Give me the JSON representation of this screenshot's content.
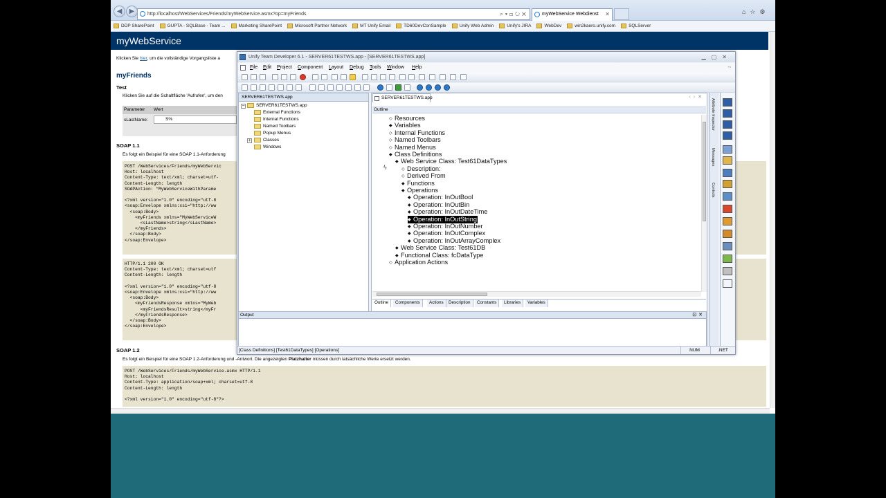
{
  "browser": {
    "url": "http://localhost/WebServices/Friends/myWebService.asmx?op=myFriends",
    "tab_title": "myWebService Webdienst",
    "favorites": [
      "DDP SharePoint",
      "GUPTA - SQLBase - Team ...",
      "Marketing SharePoint",
      "Microsoft Partner Network",
      "MT Unify Email",
      "TD60DevConSample",
      "Unify Web Admin",
      "Unify's JIRA",
      "WebDev",
      "win2kaero.unify.com",
      "SQLServer"
    ]
  },
  "page": {
    "service_title": "myWebService",
    "intro_prefix": "Klicken Sie ",
    "intro_link": "hier",
    "intro_suffix": ", um die vollständige Vorgangsliste a",
    "operation_title": "myFriends",
    "test_heading": "Test",
    "test_desc": "Klicken Sie auf die Schaltfläche 'Aufrufen', um den",
    "param_header_name": "Parameter",
    "param_header_value": "Wert",
    "param_name": "sLastName:",
    "param_value": "S%",
    "soap11_heading": "SOAP 1.1",
    "soap11_desc": "Es folgt ein Beispiel für eine SOAP 1.1-Anforderung",
    "soap11_request": "POST /WebServices/Friends/myWebServic\nHost: localhost\nContent-Type: text/xml; charset=utf-\nContent-Length: length\nSOAPAction: \"MyWebServiceWithParame\n\n<?xml version=\"1.0\" encoding=\"utf-8\n<soap:Envelope xmlns:xsi=\"http://ww\n  <soap:Body>\n    <myFriends xmlns=\"MyWebServiceW\n      <sLastName>string</sLastName>\n    </myFriends>\n  </soap:Body>\n</soap:Envelope>",
    "soap11_response": "HTTP/1.1 200 OK\nContent-Type: text/xml; charset=utf\nContent-Length: length\n\n<?xml version=\"1.0\" encoding=\"utf-8\n<soap:Envelope xmlns:xsi=\"http://ww\n  <soap:Body>\n    <myFriendsResponse xmlns=\"MyWeb\n      <myFriendsResult>string</myFr\n    </myFriendsResponse>\n  </soap:Body>\n</soap:Envelope>",
    "soap12_heading": "SOAP 1.2",
    "soap12_desc_prefix": "Es folgt ein Beispiel für eine SOAP 1.2-Anforderung und -Antwort. Die angezeigten ",
    "soap12_desc_bold": "Platzhalter",
    "soap12_desc_suffix": " müssen durch tatsächliche Werte ersetzt werden.",
    "soap12_request": "POST /WebServices/Friends/myWebService.asmx HTTP/1.1\nHost: localhost\nContent-Type: application/soap+xml; charset=utf-8\nContent-Length: length\n\n<?xml version=\"1.0\" encoding=\"utf-8\"?>"
  },
  "td": {
    "title": "Unify Team Developer 6.1 - SERVER61TESTWS.app - [SERVER61TESTWS.app]",
    "menus": [
      "File",
      "Edit",
      "Project",
      "Component",
      "Layout",
      "Debug",
      "Tools",
      "Window",
      "Help"
    ],
    "left_tab": "SERVER61TESTWS.app",
    "tree": {
      "root": "SERVER61TESTWS.app",
      "items": [
        "External Functions",
        "Internal Functions",
        "Named Toolbars",
        "Popup Menus",
        "Classes",
        "Windows"
      ]
    },
    "doc_tab": "SERVER61TESTWS.app",
    "outline_label": "Outline",
    "outline": [
      {
        "text": "Resources",
        "level": 0,
        "bullet": "◇"
      },
      {
        "text": "Variables",
        "level": 0,
        "bullet": "◆"
      },
      {
        "text": "Internal Functions",
        "level": 0,
        "bullet": "◇"
      },
      {
        "text": "Named Toolbars",
        "level": 0,
        "bullet": "◇"
      },
      {
        "text": "Named Menus",
        "level": 0,
        "bullet": "◇"
      },
      {
        "text": "Class Definitions",
        "level": 0,
        "bullet": "◆"
      },
      {
        "text": "Web Service Class: Test61DataTypes",
        "level": 1,
        "bullet": "◆"
      },
      {
        "text": "Description:",
        "level": 2,
        "bullet": "◇"
      },
      {
        "text": "Derived From",
        "level": 2,
        "bullet": "◇"
      },
      {
        "text": "Functions",
        "level": 2,
        "bullet": "◆"
      },
      {
        "text": "Operations",
        "level": 2,
        "bullet": "◆"
      },
      {
        "text": "Operation: InOutBool",
        "level": 3,
        "bullet": "◆"
      },
      {
        "text": "Operation: InOutBin",
        "level": 3,
        "bullet": "◆"
      },
      {
        "text": "Operation: InOutDateTime",
        "level": 3,
        "bullet": "◆"
      },
      {
        "text": "Operation: InOutString",
        "level": 3,
        "bullet": "◆"
      },
      {
        "text": "Operation: InOutNumber",
        "level": 3,
        "bullet": "◆"
      },
      {
        "text": "Operation: InOutComplex",
        "level": 3,
        "bullet": "◆"
      },
      {
        "text": "Operation: InOutArrayComplex",
        "level": 3,
        "bullet": "◆"
      },
      {
        "text": "Web Service Class: Test61DB",
        "level": 1,
        "bullet": "◆"
      },
      {
        "text": "Functional Class: fcDataType",
        "level": 1,
        "bullet": "◆"
      },
      {
        "text": "Application Actions",
        "level": 0,
        "bullet": "◇"
      }
    ],
    "selected_index": 14,
    "bottom_tabs": [
      "Outline",
      "Components",
      "Actions",
      "Description",
      "Constants",
      "Libraries",
      "Variables"
    ],
    "side_tabs": [
      "Attribute Inspector",
      "Messages",
      "Controls"
    ],
    "output_label": "Output",
    "status_path": "[Class Definitions] [Test61DataTypes] [Operations]",
    "status_num": "NUM",
    "status_net": ".NET"
  }
}
